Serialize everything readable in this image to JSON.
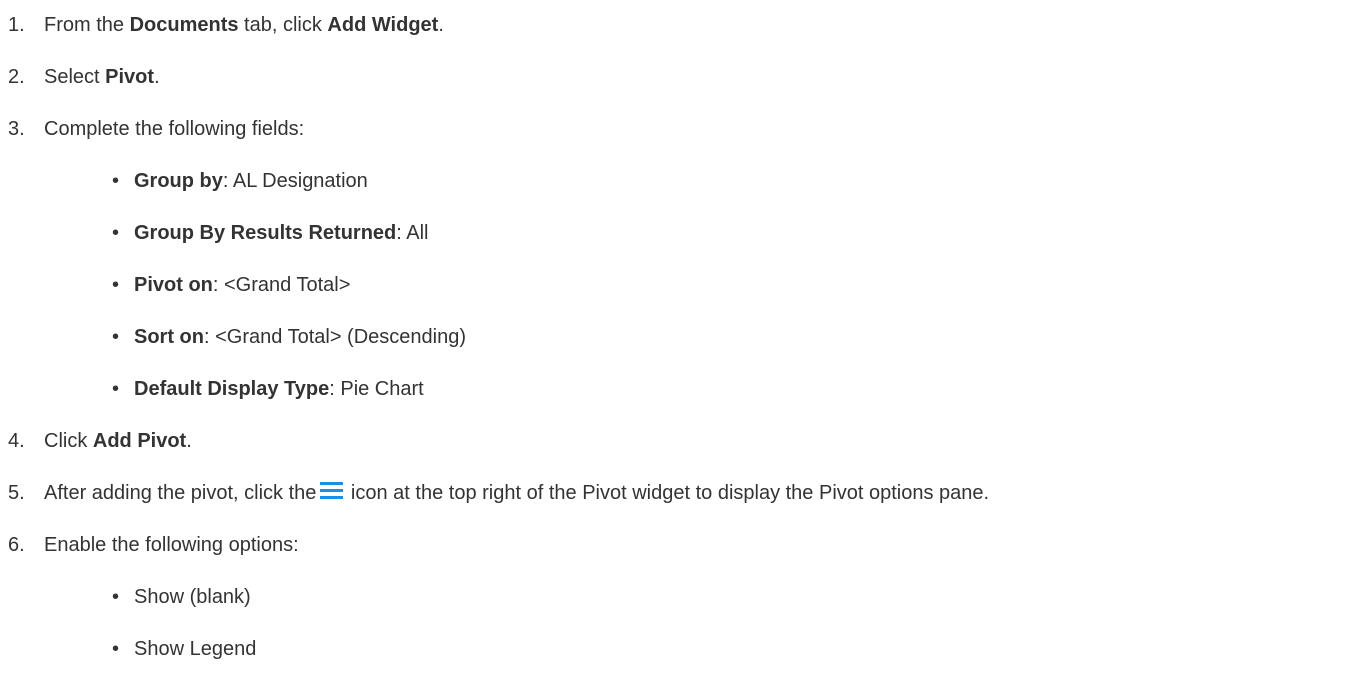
{
  "steps": [
    {
      "number": "1.",
      "pre": "From the ",
      "b1": "Documents",
      "mid": " tab, click ",
      "b2": "Add Widget",
      "post": "."
    },
    {
      "number": "2.",
      "pre": "Select ",
      "b1": "Pivot",
      "post": "."
    },
    {
      "number": "3.",
      "text": "Complete the following fields:"
    },
    {
      "number": "4.",
      "pre": "Click ",
      "b1": "Add Pivot",
      "post": "."
    },
    {
      "number": "5.",
      "pre": "After adding the pivot, click the",
      "icon": "hamburger-menu-icon",
      "post": " icon at the top right of the Pivot widget to display the Pivot options pane."
    },
    {
      "number": "6.",
      "text": "Enable the following options:"
    }
  ],
  "fields": [
    {
      "bullet": "•",
      "label": "Group by",
      "value": ": AL Designation"
    },
    {
      "bullet": "•",
      "label": "Group By Results Returned",
      "value": ": All"
    },
    {
      "bullet": "•",
      "label": "Pivot on",
      "value": ": <Grand Total>"
    },
    {
      "bullet": "•",
      "label": "Sort on",
      "value": ": <Grand Total> (Descending)"
    },
    {
      "bullet": "•",
      "label": "Default Display Type",
      "value": ": Pie Chart"
    }
  ],
  "options": [
    {
      "bullet": "•",
      "text": "Show (blank)"
    },
    {
      "bullet": "•",
      "text": "Show Legend"
    }
  ],
  "colors": {
    "text": "#333333",
    "icon": "#1a8fe3",
    "background": "#ffffff"
  }
}
